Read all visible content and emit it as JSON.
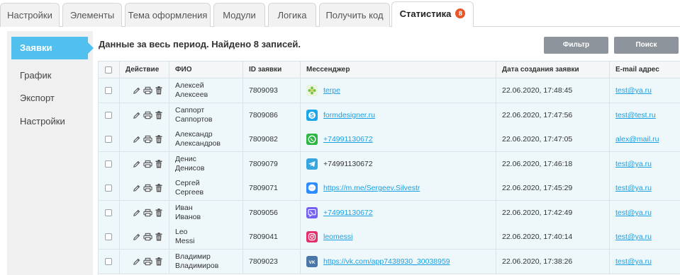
{
  "tabs": [
    {
      "label": "Настройки"
    },
    {
      "label": "Элементы"
    },
    {
      "label": "Тема оформления"
    },
    {
      "label": "Модули"
    },
    {
      "label": "Логика"
    },
    {
      "label": "Получить код"
    },
    {
      "label": "Статистика",
      "badge": "8"
    }
  ],
  "sidebar": {
    "items": [
      {
        "label": "Заявки"
      },
      {
        "label": "График"
      },
      {
        "label": "Экспорт"
      },
      {
        "label": "Настройки"
      }
    ]
  },
  "main": {
    "heading": "Данные за весь период. Найдено 8 записей.",
    "filter_label": "Фильтр",
    "search_label": "Поиск"
  },
  "table": {
    "headers": {
      "action": "Действие",
      "fio": "ФИО",
      "id": "ID заявки",
      "messenger": "Мессенджер",
      "date": "Дата создания заявки",
      "email": "E-mail адрес"
    },
    "rows": [
      {
        "first": "Алексей",
        "last": "Алексеев",
        "id": "7809093",
        "msg_type": "icq",
        "msg": "terpe",
        "msg_link": true,
        "date": "22.06.2020, 17:48:45",
        "email": "test@ya.ru"
      },
      {
        "first": "Саппорт",
        "last": "Саппортов",
        "id": "7809086",
        "msg_type": "skype",
        "msg": "formdesigner.ru",
        "msg_link": true,
        "date": "22.06.2020, 17:47:56",
        "email": "test@test.ru"
      },
      {
        "first": "Александр",
        "last": "Александров",
        "id": "7809082",
        "msg_type": "whatsapp",
        "msg": "+74991130672",
        "msg_link": true,
        "date": "22.06.2020, 17:47:05",
        "email": "alex@mail.ru"
      },
      {
        "first": "Денис",
        "last": "Денисов",
        "id": "7809079",
        "msg_type": "telegram",
        "msg": "+74991130672",
        "msg_link": false,
        "date": "22.06.2020, 17:46:18",
        "email": "test@ya.ru"
      },
      {
        "first": "Сергей",
        "last": "Сергеев",
        "id": "7809071",
        "msg_type": "messenger",
        "msg": "https://m.me/Sergeev.Silvestr",
        "msg_link": true,
        "date": "22.06.2020, 17:45:29",
        "email": "test@ya.ru"
      },
      {
        "first": "Иван",
        "last": "Иванов",
        "id": "7809056",
        "msg_type": "viber",
        "msg": "+74991130672",
        "msg_link": true,
        "date": "22.06.2020, 17:42:49",
        "email": "test@ya.ru"
      },
      {
        "first": "Leo",
        "last": "Messi",
        "id": "7809041",
        "msg_type": "instagram",
        "msg": "leomessi",
        "msg_link": true,
        "date": "22.06.2020, 17:40:14",
        "email": "test@ya.ru"
      },
      {
        "first": "Владимир",
        "last": "Владимиров",
        "id": "7809023",
        "msg_type": "vk",
        "msg": "https://vk.com/app7438930_30038959",
        "msg_link": true,
        "date": "22.06.2020, 17:38:26",
        "email": "test@ya.ru"
      }
    ]
  },
  "icons": {
    "row_actions": [
      "pencil-icon",
      "printer-icon",
      "trash-icon"
    ],
    "messengers": {
      "icq": "#7cc242",
      "skype": "#1ca6e8",
      "whatsapp": "#2cb742",
      "telegram": "#37a6de",
      "messenger": "#2d8cff",
      "viber": "#7360f2",
      "instagram": "#e1306c",
      "vk": "#4a76a8"
    }
  },
  "colors": {
    "accent": "#52c0ef",
    "badge": "#e8572a",
    "button": "#8d949c",
    "link": "#1aa0e0",
    "row_bg": "#eef8fb"
  }
}
